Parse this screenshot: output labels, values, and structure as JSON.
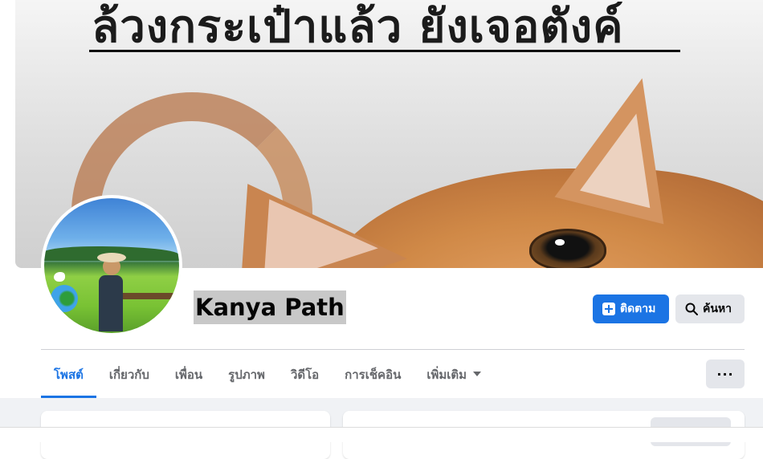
{
  "cover": {
    "headline": "ล้วงกระเป๋าแล้ว ยังเจอตังค์"
  },
  "profile": {
    "name": "Kanya Path"
  },
  "actions": {
    "follow_label": "ติดตาม",
    "search_label": "ค้นหา"
  },
  "tabs": [
    {
      "label": "โพสต์",
      "active": true
    },
    {
      "label": "เกี่ยวกับ",
      "active": false
    },
    {
      "label": "เพื่อน",
      "active": false
    },
    {
      "label": "รูปภาพ",
      "active": false
    },
    {
      "label": "วิดีโอ",
      "active": false
    },
    {
      "label": "การเช็คอิน",
      "active": false
    },
    {
      "label": "เพิ่มเติม",
      "active": false
    }
  ],
  "more_menu_label": "···",
  "colors": {
    "accent": "#1b74e4",
    "button_gray": "#e4e6eb",
    "feed_background": "#f0f2f5"
  }
}
